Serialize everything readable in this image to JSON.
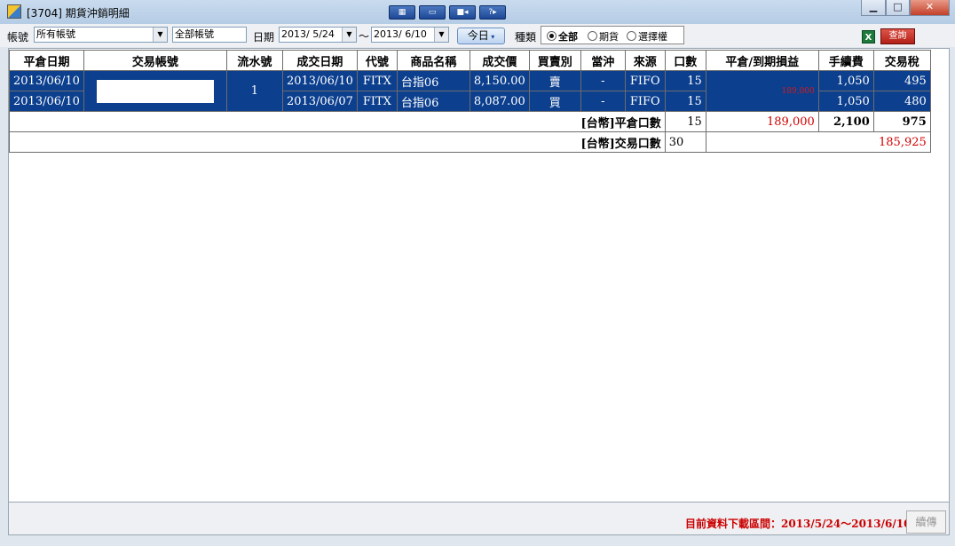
{
  "window": {
    "title": "[3704] 期貨沖銷明細",
    "toolbar_buttons": [
      "window-tile-icon",
      "window-fit-icon",
      "video-icon",
      "help-icon"
    ],
    "controls": {
      "minimize": "▁",
      "maximize": "□",
      "close": "✕"
    }
  },
  "filter": {
    "account_label": "帳號",
    "account_value": "所有帳號",
    "account_name": "全部帳號",
    "date_label": "日期",
    "date_from": "2013/ 5/24",
    "date_sep": "～",
    "date_to": "2013/ 6/10",
    "today_button": "今日",
    "type_label": "種類",
    "types": [
      "全部",
      "期貨",
      "選擇權"
    ],
    "type_selected": "全部",
    "print_label": "查詢"
  },
  "table": {
    "headers": [
      "平倉日期",
      "交易帳號",
      "流水號",
      "成交日期",
      "代號",
      "商品名稱",
      "成交價",
      "買賣別",
      "當沖",
      "來源",
      "口數",
      "平倉/到期損益",
      "手續費",
      "交易稅"
    ],
    "group": {
      "serial": "1",
      "pnl": "189,000"
    },
    "rows": [
      {
        "close_date": "2013/06/10",
        "trade_date": "2013/06/10",
        "code": "FITX",
        "product": "台指06",
        "price": "8,150.00",
        "side": "賣",
        "daytrade": "-",
        "source": "FIFO",
        "qty": "15",
        "fee": "1,050",
        "tax": "495"
      },
      {
        "close_date": "2013/06/10",
        "trade_date": "2013/06/07",
        "code": "FITX",
        "product": "台指06",
        "price": "8,087.00",
        "side": "買",
        "daytrade": "-",
        "source": "FIFO",
        "qty": "15",
        "fee": "1,050",
        "tax": "480"
      }
    ],
    "summary1": {
      "label": "[台幣]平倉口數",
      "qty": "15",
      "pnl": "189,000",
      "fee": "2,100",
      "tax": "975"
    },
    "summary2": {
      "label": "[台幣]交易口數",
      "qty": "30",
      "net": "185,925"
    }
  },
  "status": {
    "text": "目前資料下載區間：2013/5/24～2013/6/10",
    "reload_button": "續傳"
  },
  "colors": {
    "selected_row": "#0c3f8e",
    "sell": "#30c030",
    "buy": "#e02020",
    "profit": "#d10000"
  }
}
